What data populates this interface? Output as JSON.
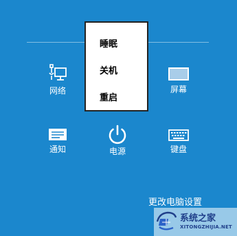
{
  "settings": {
    "network_label": "网络",
    "screen_label": "屏幕",
    "notifications_label": "通知",
    "power_label": "电源",
    "keyboard_label": "键盘",
    "change_pc_settings": "更改电脑设置"
  },
  "power_menu": {
    "items": [
      {
        "label": "睡眠"
      },
      {
        "label": "关机"
      },
      {
        "label": "重启"
      }
    ]
  },
  "watermark": {
    "site_name": "系统之家",
    "site_url": "XITONGZHIJIA.NET"
  },
  "colors": {
    "background": "#1b87cd",
    "menu_background": "#ffffff",
    "menu_border": "#222222",
    "text": "#ffffff"
  },
  "icons": [
    "network-icon",
    "screen-icon",
    "notifications-icon",
    "power-icon",
    "keyboard-icon"
  ]
}
